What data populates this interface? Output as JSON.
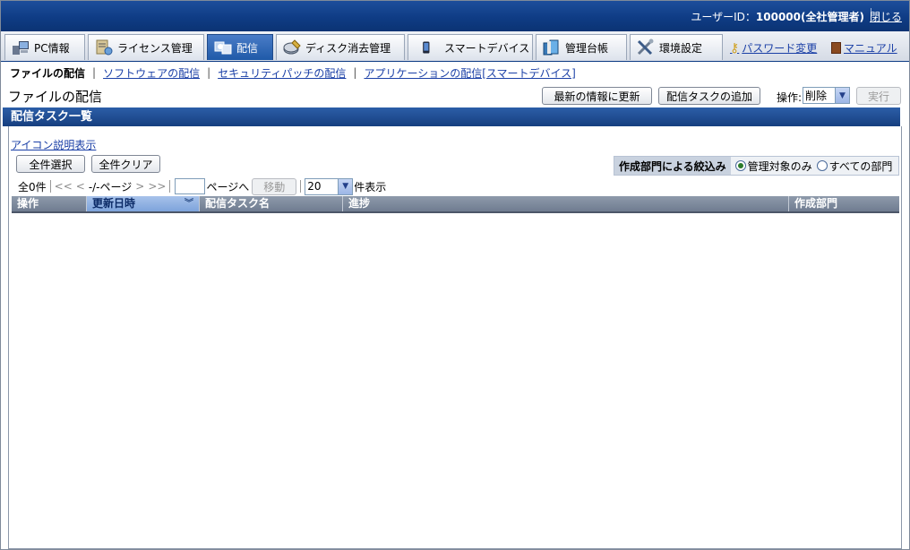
{
  "header": {
    "user_prefix": "ユーザーID：",
    "user_id": "100000",
    "user_role": "(全社管理者)",
    "close_label": "閉じる"
  },
  "nav": {
    "tabs": [
      {
        "label": "PC情報",
        "icon": "pc-icon"
      },
      {
        "label": "ライセンス管理",
        "icon": "license-icon"
      },
      {
        "label": "配信",
        "icon": "distribution-icon",
        "active": true
      },
      {
        "label": "ディスク消去管理",
        "icon": "disk-erase-icon"
      },
      {
        "label": "スマートデバイス",
        "icon": "smart-device-icon"
      },
      {
        "label": "管理台帳",
        "icon": "ledger-icon"
      },
      {
        "label": "環境設定",
        "icon": "settings-tools-icon"
      }
    ],
    "password_link": "パスワード変更",
    "manual_link": "マニュアル"
  },
  "subnav": {
    "current": "ファイルの配信",
    "links": [
      "ソフトウェアの配信",
      "セキュリティパッチの配信",
      "アプリケーションの配信[スマートデバイス]"
    ]
  },
  "page": {
    "title": "ファイルの配信",
    "refresh_button": "最新の情報に更新",
    "add_task_button": "配信タスクの追加",
    "operation_label": "操作:",
    "operation_value": "削除",
    "execute_button": "実行"
  },
  "section": {
    "title": "配信タスク一覧",
    "icon_help": "アイコン説明表示",
    "select_all": "全件選択",
    "clear_all": "全件クリア"
  },
  "filter": {
    "label": "作成部門による絞込み",
    "option_managed": "管理対象のみ",
    "option_all": "すべての部門",
    "selected": "管理対象のみ"
  },
  "pager": {
    "total": "全0件",
    "first": "<<",
    "prev": "<",
    "page_info": "-/-ページ",
    "next": ">",
    "last": ">>",
    "goto_suffix": "ページへ",
    "move_button": "移動",
    "per_page": "20",
    "per_page_suffix": "件表示"
  },
  "table": {
    "columns": [
      "操作",
      "更新日時",
      "配信タスク名",
      "進捗",
      "作成部門"
    ],
    "sorted_column": "更新日時",
    "rows": []
  },
  "colors": {
    "header_blue": "#0f3c85",
    "link": "#1a3fa6",
    "table_header": "#7a8699"
  }
}
